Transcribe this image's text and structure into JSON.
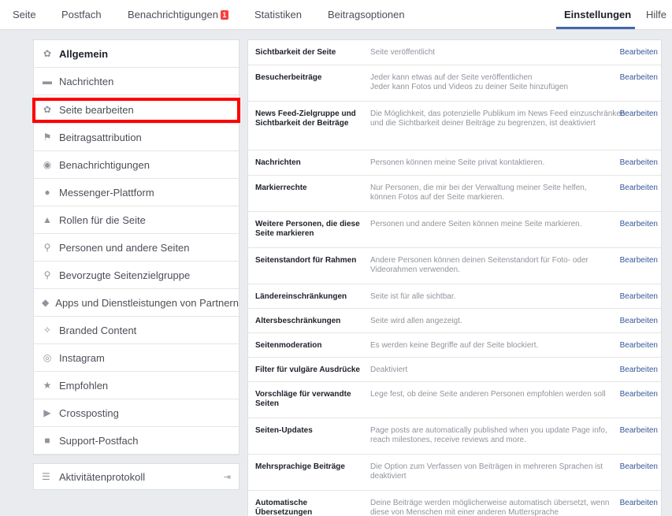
{
  "nav": {
    "tabs": [
      "Seite",
      "Postfach",
      "Benachrichtigungen",
      "Statistiken",
      "Beitragsoptionen",
      "Einstellungen",
      "Hilfe"
    ],
    "badge": "1",
    "active": "Einstellungen"
  },
  "sidebar": {
    "items": [
      {
        "label": "Allgemein",
        "icon": "gear-icon"
      },
      {
        "label": "Nachrichten",
        "icon": "message-icon"
      },
      {
        "label": "Seite bearbeiten",
        "icon": "gear-icon"
      },
      {
        "label": "Beitragsattribution",
        "icon": "flag-icon"
      },
      {
        "label": "Benachrichtigungen",
        "icon": "globe-icon"
      },
      {
        "label": "Messenger-Plattform",
        "icon": "messenger-icon"
      },
      {
        "label": "Rollen für die Seite",
        "icon": "person-icon"
      },
      {
        "label": "Personen und andere Seiten",
        "icon": "people-icon"
      },
      {
        "label": "Bevorzugte Seitenzielgruppe",
        "icon": "people-icon"
      },
      {
        "label": "Apps und Dienstleistungen von Partnern",
        "icon": "cube-icon"
      },
      {
        "label": "Branded Content",
        "icon": "handshake-icon"
      },
      {
        "label": "Instagram",
        "icon": "instagram-icon"
      },
      {
        "label": "Empfohlen",
        "icon": "star-icon"
      },
      {
        "label": "Crossposting",
        "icon": "video-icon"
      },
      {
        "label": "Support-Postfach",
        "icon": "facebook-icon"
      }
    ],
    "activity": {
      "label": "Aktivitätenprotokoll",
      "icon": "list-icon"
    }
  },
  "settings": {
    "edit_label": "Bearbeiten",
    "rows": [
      {
        "key": "Sichtbarkeit der Seite",
        "value": "Seite veröffentlicht"
      },
      {
        "key": "Besucherbeiträge",
        "value": "Jeder kann etwas auf der Seite veröffentlichen\nJeder kann Fotos und Videos zu deiner Seite hinzufügen"
      },
      {
        "key": "News Feed-Zielgruppe und Sichtbarkeit der Beiträge",
        "value": "Die Möglichkeit, das potenzielle Publikum im News Feed einzuschränken und die Sichtbarkeit deiner Beiträge zu begrenzen, ist deaktiviert"
      },
      {
        "key": "Nachrichten",
        "value": "Personen können meine Seite privat kontaktieren."
      },
      {
        "key": "Markierrechte",
        "value": "Nur Personen, die mir bei der Verwaltung meiner Seite helfen, können Fotos auf der Seite markieren."
      },
      {
        "key": "Weitere Personen, die diese Seite markieren",
        "value": "Personen und andere Seiten können meine Seite markieren."
      },
      {
        "key": "Seitenstandort für Rahmen",
        "value": "Andere Personen können deinen Seitenstandort für Foto- oder Videorahmen verwenden."
      },
      {
        "key": "Ländereinschränkungen",
        "value": "Seite ist für alle sichtbar."
      },
      {
        "key": "Altersbeschränkungen",
        "value": "Seite wird allen angezeigt."
      },
      {
        "key": "Seitenmoderation",
        "value": "Es werden keine Begriffe auf der Seite blockiert."
      },
      {
        "key": "Filter für vulgäre Ausdrücke",
        "value": "Deaktiviert"
      },
      {
        "key": "Vorschläge für verwandte Seiten",
        "value": "Lege fest, ob deine Seite anderen Personen empfohlen werden soll"
      },
      {
        "key": "Seiten-Updates",
        "value": "Page posts are automatically published when you update Page info, reach milestones, receive reviews and more."
      },
      {
        "key": "Mehrsprachige Beiträge",
        "value": "Die Option zum Verfassen von Beiträgen in mehreren Sprachen ist deaktiviert"
      },
      {
        "key": "Automatische Übersetzungen",
        "value": "Deine Beiträge werden möglicherweise automatisch übersetzt, wenn diese von Menschen mit einer anderen Muttersprache"
      }
    ]
  },
  "colors": {
    "link": "#365899",
    "highlight": "#ff0000",
    "active_underline": "#4267b2",
    "badge": "#fa3e3e"
  }
}
